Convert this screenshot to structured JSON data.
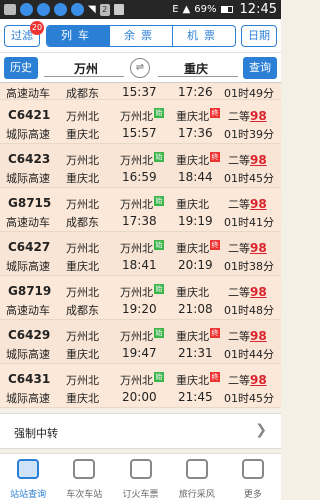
{
  "status": {
    "signal": "E",
    "battery": "69%",
    "time": "12:45"
  },
  "header": {
    "filter_label": "过滤",
    "filter_badge": "20",
    "tabs": [
      "列车",
      "余票",
      "机票"
    ],
    "active_tab": 0,
    "date_label": "日期"
  },
  "route": {
    "history_label": "历史",
    "from": "万州",
    "to": "重庆",
    "query_label": "查询"
  },
  "trains": [
    {
      "no": "",
      "type": "高速动车",
      "station": "成都东",
      "dep_station": "",
      "dep_tag": "",
      "dep_time": "15:37",
      "arr_station": "",
      "arr_tag": "",
      "arr_time": "17:26",
      "seat": "",
      "count": "",
      "duration": "01时49分"
    },
    {
      "no": "C6421",
      "type": "城际高速",
      "station": "重庆北",
      "dep_station": "万州北",
      "dep_tag": "始",
      "dep_time": "15:57",
      "arr_station": "重庆北",
      "arr_tag": "终",
      "arr_time": "17:36",
      "seat": "二等",
      "count": "98",
      "duration": "01时39分"
    },
    {
      "no": "C6423",
      "type": "城际高速",
      "station": "重庆北",
      "dep_station": "万州北",
      "dep_tag": "始",
      "dep_time": "16:59",
      "arr_station": "重庆北",
      "arr_tag": "终",
      "arr_time": "18:44",
      "seat": "二等",
      "count": "98",
      "duration": "01时45分"
    },
    {
      "no": "G8715",
      "type": "高速动车",
      "station": "成都东",
      "dep_station": "万州北",
      "dep_tag": "始",
      "dep_time": "17:38",
      "arr_station": "重庆北",
      "arr_tag": "",
      "arr_time": "19:19",
      "seat": "二等",
      "count": "98",
      "duration": "01时41分"
    },
    {
      "no": "C6427",
      "type": "城际高速",
      "station": "重庆北",
      "dep_station": "万州北",
      "dep_tag": "始",
      "dep_time": "18:41",
      "arr_station": "重庆北",
      "arr_tag": "终",
      "arr_time": "20:19",
      "seat": "二等",
      "count": "98",
      "duration": "01时38分"
    },
    {
      "no": "G8719",
      "type": "高速动车",
      "station": "成都东",
      "dep_station": "万州北",
      "dep_tag": "始",
      "dep_time": "19:20",
      "arr_station": "重庆北",
      "arr_tag": "",
      "arr_time": "21:08",
      "seat": "二等",
      "count": "98",
      "duration": "01时48分"
    },
    {
      "no": "C6429",
      "type": "城际高速",
      "station": "重庆北",
      "dep_station": "万州北",
      "dep_tag": "始",
      "dep_time": "19:47",
      "arr_station": "重庆北",
      "arr_tag": "终",
      "arr_time": "21:31",
      "seat": "二等",
      "count": "98",
      "duration": "01时44分"
    },
    {
      "no": "C6431",
      "type": "城际高速",
      "station": "重庆北",
      "dep_station": "万州北",
      "dep_tag": "始",
      "dep_time": "20:00",
      "arr_station": "重庆北",
      "arr_tag": "终",
      "arr_time": "21:45",
      "seat": "二等",
      "count": "98",
      "duration": "01时45分"
    }
  ],
  "transfer_label": "强制中转",
  "tabbar": [
    {
      "label": "站站查询",
      "icon": "train-icon"
    },
    {
      "label": "车次车站",
      "icon": "station-icon"
    },
    {
      "label": "订火车票",
      "icon": "ticket-icon"
    },
    {
      "label": "旅行采风",
      "icon": "chat-icon"
    },
    {
      "label": "更多",
      "icon": "grid-icon"
    }
  ],
  "colors": {
    "accent": "#2b7fd4",
    "row_bg": "#fbe8d8",
    "count": "#d9232e",
    "start_tag": "#3cb44b",
    "end_tag": "#e33333"
  }
}
